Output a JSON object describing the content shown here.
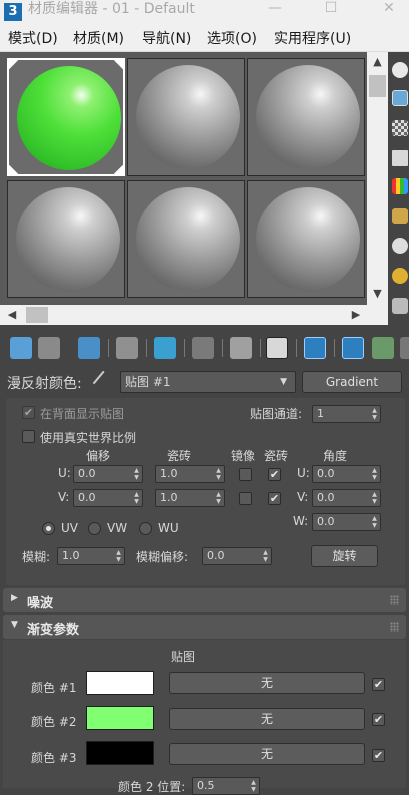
{
  "window": {
    "title": "材质编辑器 - 01 - Default",
    "minimize": "—",
    "maximize": "☐",
    "close": "✕"
  },
  "menu": [
    "模式(D)",
    "材质(M)",
    "导航(N)",
    "选项(O)",
    "实用程序(U)"
  ],
  "slots": {
    "count": 6,
    "selected_index": 0,
    "selected_color": "#4fe03a"
  },
  "diffuse": {
    "label": "漫反射颜色:",
    "map_name": "贴图 #1",
    "map_type": "Gradient"
  },
  "coordinates": {
    "show_map_on_back": "在背面显示贴图",
    "map_channel_label": "贴图通道:",
    "map_channel": "1",
    "use_real_world": "使用真实世界比例",
    "col_offset": "偏移",
    "col_tiling": "瓷砖",
    "col_mirror": "镜像",
    "col_tile": "瓷砖",
    "col_angle": "角度",
    "u_label": "U:",
    "v_label": "V:",
    "w_label": "W:",
    "u_offset": "0.0",
    "v_offset": "0.0",
    "u_tiling": "1.0",
    "v_tiling": "1.0",
    "u_angle": "0.0",
    "v_angle": "0.0",
    "w_angle": "0.0",
    "radio_uv": "UV",
    "radio_vw": "VW",
    "radio_wu": "WU",
    "blur_label": "模糊:",
    "blur": "1.0",
    "blur_offset_label": "模糊偏移:",
    "blur_offset": "0.0",
    "rotate_button": "旋转"
  },
  "rollouts": {
    "noise": "噪波",
    "gradient_params": "渐变参数"
  },
  "gradient": {
    "map_header": "贴图",
    "colors": [
      {
        "label": "颜色 #1",
        "hex": "#ffffff",
        "map": "无"
      },
      {
        "label": "颜色 #2",
        "hex": "#80ff70",
        "map": "无"
      },
      {
        "label": "颜色 #3",
        "hex": "#000000",
        "map": "无"
      }
    ],
    "color2_pos_label": "颜色 2 位置:",
    "color2_pos": "0.5"
  }
}
